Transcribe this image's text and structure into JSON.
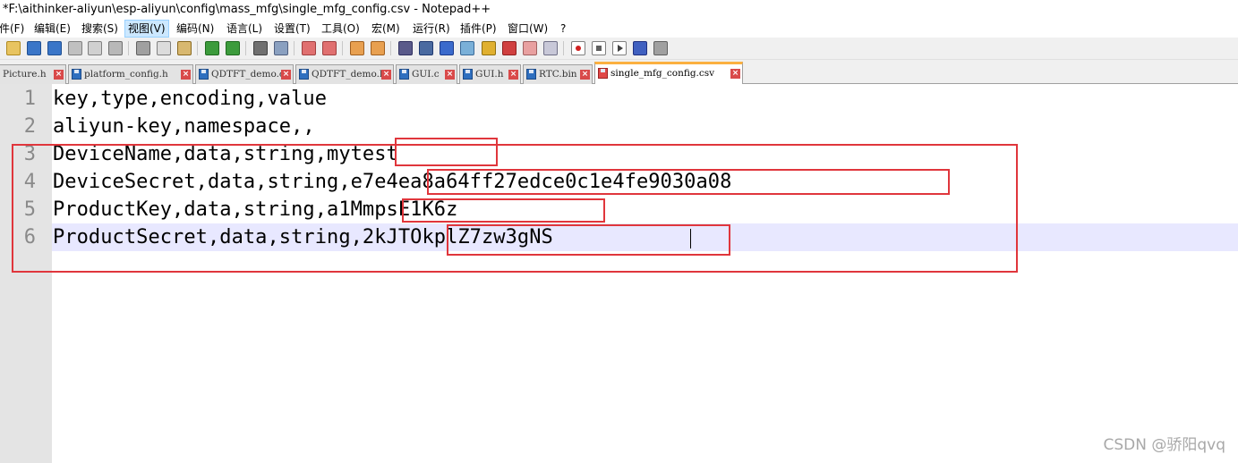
{
  "window": {
    "title": "*F:\\aithinker-aliyun\\esp-aliyun\\config\\mass_mfg\\single_mfg_config.csv - Notepad++"
  },
  "menu": [
    "件(F)",
    "编辑(E)",
    "搜索(S)",
    "视图(V)",
    "编码(N)",
    "语言(L)",
    "设置(T)",
    "工具(O)",
    "宏(M)",
    "运行(R)",
    "插件(P)",
    "窗口(W)",
    "?"
  ],
  "tabs": [
    {
      "label": "Picture.h"
    },
    {
      "label": "platform_config.h"
    },
    {
      "label": "QDTFT_demo.c"
    },
    {
      "label": "QDTFT_demo.h"
    },
    {
      "label": "GUI.c"
    },
    {
      "label": "GUI.h"
    },
    {
      "label": "RTC.bin"
    },
    {
      "label": "single_mfg_config.csv"
    }
  ],
  "editor": {
    "line_numbers": [
      "1",
      "2",
      "3",
      "4",
      "5",
      "6"
    ],
    "lines": [
      "key,type,encoding,value",
      "aliyun-key,namespace,,",
      "DeviceName,data,string,mytest",
      "DeviceSecret,data,string,e7e4ea8a64ff27edce0c1e4fe9030a08",
      "ProductKey,data,string,a1MmpsE1K6z",
      "ProductSecret,data,string,2kJTOkplZ7zw3gNS"
    ]
  },
  "watermark": "CSDN @骄阳qvq",
  "colors": {
    "highlight_box": "#e0363c",
    "current_line": "#e8e8ff",
    "active_tab_accent": "#fbb040"
  }
}
